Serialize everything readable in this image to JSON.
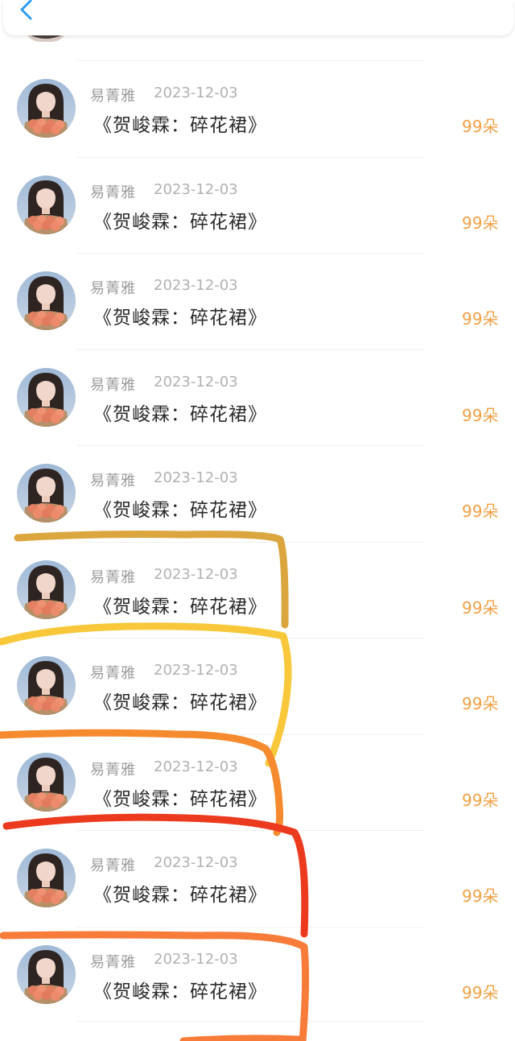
{
  "nav": {
    "back_icon": "chevron-left-icon"
  },
  "colors": {
    "accent_blue": "#2f9bf0",
    "amount_orange": "#f2a046",
    "name_gray": "#9b9b9b",
    "title_dark": "#2a2a2a",
    "scribble_colors": [
      "#dca63f",
      "#f8c83a",
      "#f58a2e",
      "#ec3a1e",
      "#f77b39"
    ]
  },
  "gift_list": [
    {
      "name": "易菁雅",
      "date": "2023-12-03",
      "title": "《贺峻霖：碎花裙》",
      "amount": "99朵"
    },
    {
      "name": "易菁雅",
      "date": "2023-12-03",
      "title": "《贺峻霖：碎花裙》",
      "amount": "99朵"
    },
    {
      "name": "易菁雅",
      "date": "2023-12-03",
      "title": "《贺峻霖：碎花裙》",
      "amount": "99朵"
    },
    {
      "name": "易菁雅",
      "date": "2023-12-03",
      "title": "《贺峻霖：碎花裙》",
      "amount": "99朵"
    },
    {
      "name": "易菁雅",
      "date": "2023-12-03",
      "title": "《贺峻霖：碎花裙》",
      "amount": "99朵"
    },
    {
      "name": "易菁雅",
      "date": "2023-12-03",
      "title": "《贺峻霖：碎花裙》",
      "amount": "99朵"
    },
    {
      "name": "易菁雅",
      "date": "2023-12-03",
      "title": "《贺峻霖：碎花裙》",
      "amount": "99朵"
    },
    {
      "name": "易菁雅",
      "date": "2023-12-03",
      "title": "《贺峻霖：碎花裙》",
      "amount": "99朵"
    },
    {
      "name": "易菁雅",
      "date": "2023-12-03",
      "title": "《贺峻霖：碎花裙》",
      "amount": "99朵"
    },
    {
      "name": "易菁雅",
      "date": "2023-12-03",
      "title": "《贺峻霖：碎花裙》",
      "amount": "99朵"
    }
  ]
}
